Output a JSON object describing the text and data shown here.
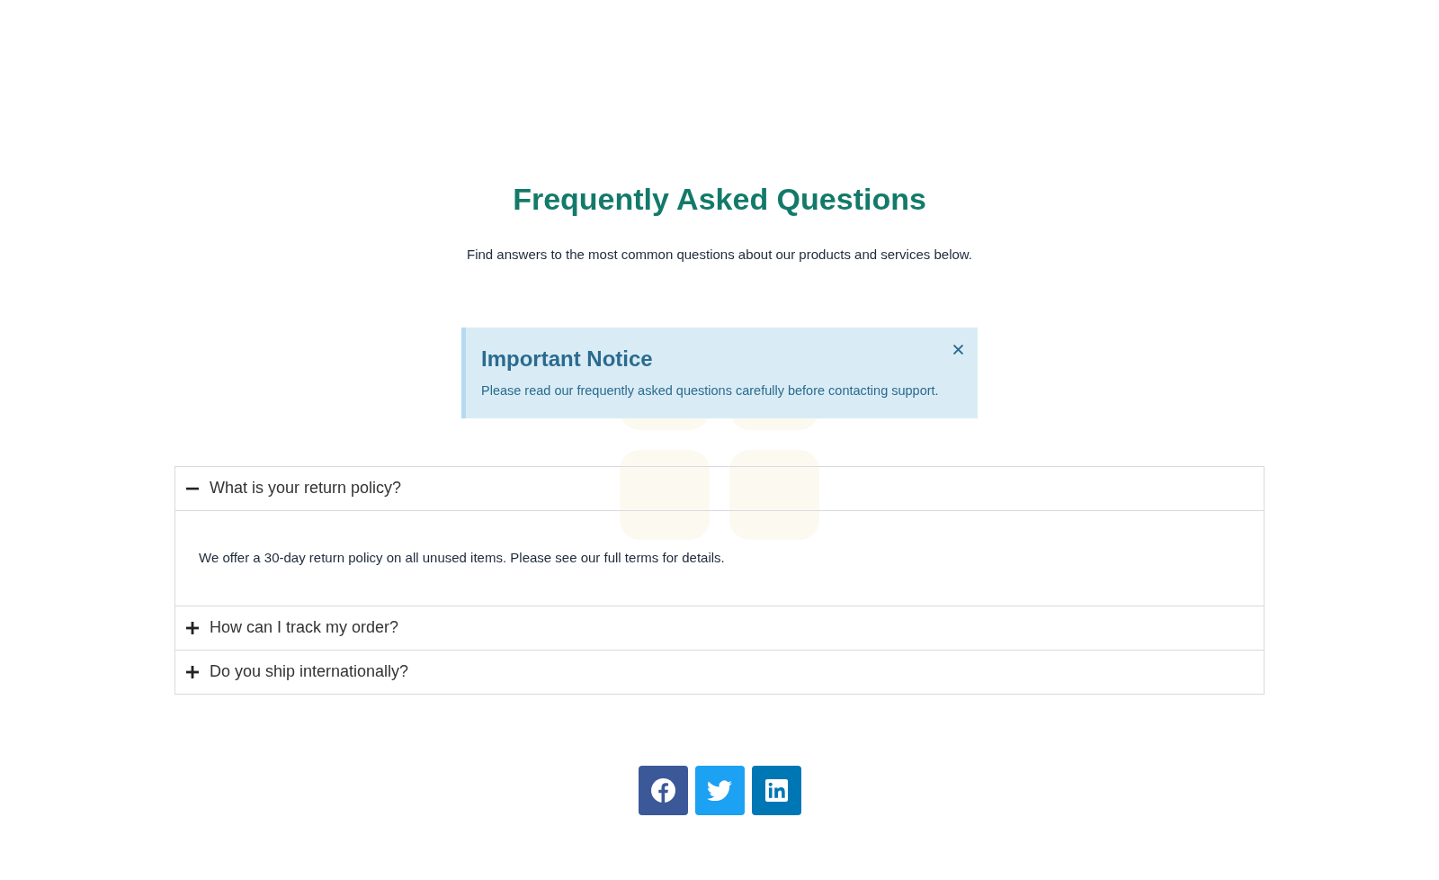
{
  "header": {
    "title": "Frequently Asked Questions",
    "subtitle": "Find answers to the most common questions about our products and services below."
  },
  "notice": {
    "title": "Important Notice",
    "message": "Please read our frequently asked questions carefully before contacting support.",
    "dismissible": true
  },
  "faq": [
    {
      "question": "What is your return policy?",
      "expanded": true,
      "answer": "We offer a 30-day return policy on all unused items. Please see our full terms for details."
    },
    {
      "question": "How can I track my order?",
      "expanded": false
    },
    {
      "question": "Do you ship internationally?",
      "expanded": false
    }
  ],
  "social_links": [
    {
      "kind": "facebook",
      "color": "#3b5998"
    },
    {
      "kind": "twitter",
      "color": "#1da1f2"
    },
    {
      "kind": "linkedin",
      "color": "#0077b5"
    }
  ]
}
